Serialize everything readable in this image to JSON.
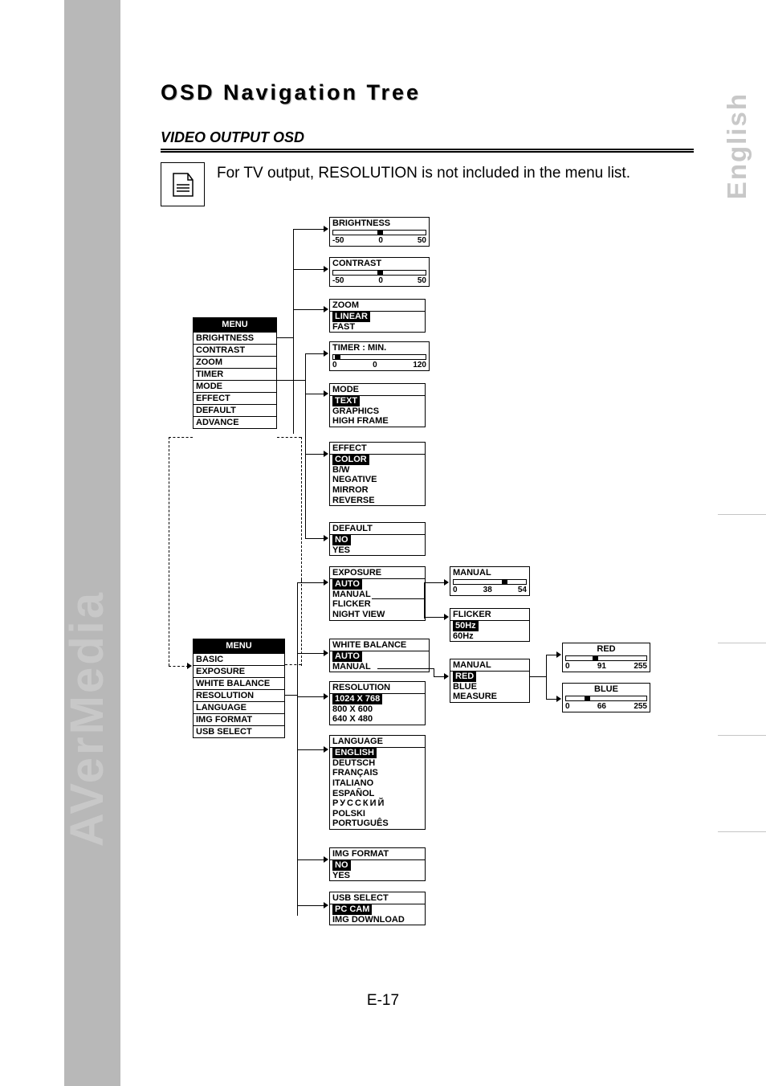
{
  "side": {
    "english": "English",
    "brand": "AVerMedia"
  },
  "title": "OSD Navigation Tree",
  "subtitle": "VIDEO OUTPUT OSD",
  "note": "For TV output, RESOLUTION is not included in the menu list.",
  "page_num": "E-17",
  "menu1": {
    "header": "MENU",
    "items": [
      "BRIGHTNESS",
      "CONTRAST",
      "ZOOM",
      "TIMER",
      "MODE",
      "EFFECT",
      "DEFAULT",
      "ADVANCE"
    ]
  },
  "menu2": {
    "header": "MENU",
    "items": [
      "BASIC",
      "EXPOSURE",
      "WHITE BALANCE",
      "RESOLUTION",
      "LANGUAGE",
      "IMG FORMAT",
      "USB SELECT"
    ]
  },
  "brightness": {
    "title": "BRIGHTNESS",
    "min": "-50",
    "mid": "0",
    "max": "50",
    "pos": 0.5
  },
  "contrast": {
    "title": "CONTRAST",
    "min": "-50",
    "mid": "0",
    "max": "50",
    "pos": 0.5
  },
  "zoom": {
    "title": "ZOOM",
    "sel": "LINEAR",
    "opts": [
      "FAST"
    ]
  },
  "timer": {
    "title": "TIMER : MIN.",
    "min": "0",
    "mid": "0",
    "max": "120",
    "pos": 0.04
  },
  "mode": {
    "title": "MODE",
    "sel": "TEXT",
    "opts": [
      "GRAPHICS",
      "HIGH FRAME"
    ]
  },
  "effect": {
    "title": "EFFECT",
    "sel": "COLOR",
    "opts": [
      "B/W",
      "NEGATIVE",
      "MIRROR",
      "REVERSE"
    ]
  },
  "default": {
    "title": "DEFAULT",
    "sel": "NO",
    "opts": [
      "YES"
    ]
  },
  "exposure": {
    "title": "EXPOSURE",
    "sel": "AUTO",
    "opts": [
      "MANUAL",
      "FLICKER",
      "NIGHT VIEW"
    ]
  },
  "exp_manual": {
    "title": "MANUAL",
    "min": "0",
    "mid": "38",
    "max": "54",
    "pos": 0.7
  },
  "flicker": {
    "title": "FLICKER",
    "sel": "50Hz",
    "opts": [
      "60Hz"
    ]
  },
  "whitebal": {
    "title": "WHITE BALANCE",
    "sel": "AUTO",
    "opts": [
      "MANUAL"
    ]
  },
  "wb_manual": {
    "title": "MANUAL",
    "sel": "RED",
    "opts": [
      "BLUE",
      "MEASURE"
    ]
  },
  "red": {
    "title": "RED",
    "min": "0",
    "mid": "91",
    "max": "255",
    "pos": 0.36
  },
  "blue": {
    "title": "BLUE",
    "min": "0",
    "mid": "66",
    "max": "255",
    "pos": 0.26
  },
  "resolution": {
    "title": "RESOLUTION",
    "sel": "1024 X 768",
    "opts": [
      "800 X 600",
      "640 X 480"
    ]
  },
  "language": {
    "title": "LANGUAGE",
    "sel": "ENGLISH",
    "opts": [
      "DEUTSCH",
      "FRANÇAIS",
      "ITALIANO",
      "ESPAÑOL",
      "РУССКИЙ",
      "POLSKI",
      "PORTUGUÊS"
    ]
  },
  "imgfmt": {
    "title": "IMG FORMAT",
    "sel": "NO",
    "opts": [
      "YES"
    ]
  },
  "usbsel": {
    "title": "USB SELECT",
    "sel": "PC CAM",
    "opts": [
      "IMG DOWNLOAD"
    ]
  }
}
